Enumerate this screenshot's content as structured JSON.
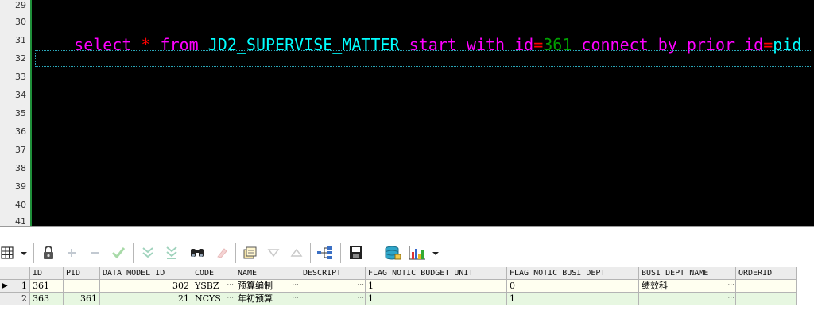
{
  "editor": {
    "line_numbers": [
      "29",
      "30",
      "31",
      "32",
      "33",
      "34",
      "35",
      "36",
      "37",
      "38",
      "39",
      "40",
      "41"
    ],
    "tokens": [
      {
        "text": "select ",
        "kind": "kw"
      },
      {
        "text": "*",
        "kind": "op"
      },
      {
        "text": " from ",
        "kind": "kw"
      },
      {
        "text": "JD2_SUPERVISE_MATTER",
        "kind": "id"
      },
      {
        "text": " start with ",
        "kind": "kw"
      },
      {
        "text": "id",
        "kind": "kw"
      },
      {
        "text": "=",
        "kind": "op"
      },
      {
        "text": "361",
        "kind": "num"
      },
      {
        "text": " connect by prior ",
        "kind": "kw"
      },
      {
        "text": "id",
        "kind": "kw"
      },
      {
        "text": "=",
        "kind": "op"
      },
      {
        "text": "pid",
        "kind": "id"
      }
    ],
    "colors": {
      "keyword": "#ff00ff",
      "operator": "#ff0000",
      "identifier": "#00ffff",
      "number": "#00a000",
      "background": "#000000"
    }
  },
  "toolbar": {
    "buttons": [
      "grid-menu-icon",
      "lock-icon",
      "add-icon",
      "remove-icon",
      "check-icon",
      "move-down-icon",
      "move-last-icon",
      "find-icon",
      "clear-icon",
      "export-icon",
      "sort-desc-icon",
      "sort-asc-icon",
      "tree-icon",
      "save-icon",
      "database-icon",
      "chart-icon"
    ]
  },
  "grid": {
    "columns": [
      "ID",
      "PID",
      "DATA_MODEL_ID",
      "CODE",
      "NAME",
      "DESCRIPT",
      "FLAG_NOTIC_BUDGET_UNIT",
      "FLAG_NOTIC_BUSI_DEPT",
      "BUSI_DEPT_NAME",
      "ORDERID"
    ],
    "rows": [
      {
        "index": "1",
        "ID": "361",
        "PID": "",
        "DATA_MODEL_ID": "302",
        "CODE": "YSBZ",
        "NAME": "预算编制",
        "DESCRIPT": "",
        "FLAG_NOTIC_BUDGET_UNIT": "1",
        "FLAG_NOTIC_BUSI_DEPT": "0",
        "BUSI_DEPT_NAME": "绩效科",
        "ORDERID": ""
      },
      {
        "index": "2",
        "ID": "363",
        "PID": "361",
        "DATA_MODEL_ID": "21",
        "CODE": "NCYS",
        "NAME": "年初预算",
        "DESCRIPT": "",
        "FLAG_NOTIC_BUDGET_UNIT": "1",
        "FLAG_NOTIC_BUSI_DEPT": "1",
        "BUSI_DEPT_NAME": "",
        "ORDERID": ""
      }
    ],
    "cell_ellipsis": "···"
  }
}
